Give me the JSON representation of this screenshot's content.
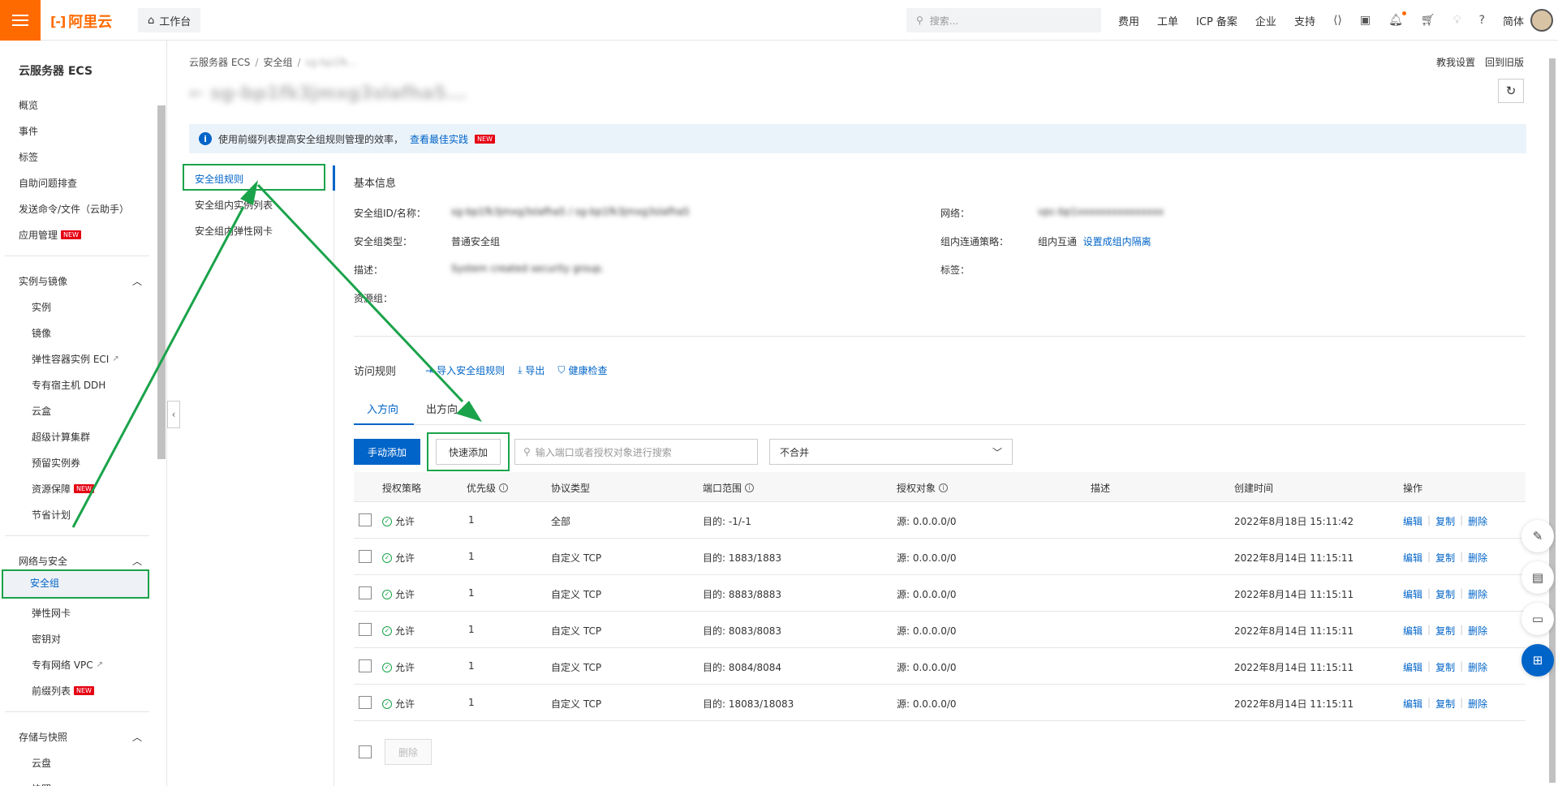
{
  "topbar": {
    "logo_text": "阿里云",
    "logo_mark": "[-]",
    "workbench_label": "工作台",
    "search_placeholder": "搜索...",
    "links": [
      "费用",
      "工单",
      "ICP 备案",
      "企业",
      "支持"
    ],
    "language": "简体",
    "icons": [
      "code-icon",
      "terminal-icon",
      "bell-icon",
      "cart-icon",
      "help-icon"
    ]
  },
  "sidebar": {
    "title": "云服务器 ECS",
    "top_items": [
      {
        "label": "概览"
      },
      {
        "label": "事件"
      },
      {
        "label": "标签"
      },
      {
        "label": "自助问题排查"
      },
      {
        "label": "发送命令/文件（云助手）"
      },
      {
        "label": "应用管理",
        "badge": "NEW"
      }
    ],
    "groups": [
      {
        "title": "实例与镜像",
        "items": [
          {
            "label": "实例"
          },
          {
            "label": "镜像"
          },
          {
            "label": "弹性容器实例 ECI",
            "external": true
          },
          {
            "label": "专有宿主机 DDH"
          },
          {
            "label": "云盒"
          },
          {
            "label": "超级计算集群"
          },
          {
            "label": "预留实例券"
          },
          {
            "label": "资源保障",
            "badge": "NEW"
          },
          {
            "label": "节省计划"
          }
        ]
      },
      {
        "title": "网络与安全",
        "items": [
          {
            "label": "安全组",
            "active": true
          },
          {
            "label": "弹性网卡"
          },
          {
            "label": "密钥对"
          },
          {
            "label": "专有网络 VPC",
            "external": true
          },
          {
            "label": "前缀列表",
            "badge": "NEW"
          }
        ]
      },
      {
        "title": "存储与快照",
        "items": [
          {
            "label": "云盘"
          },
          {
            "label": "快照"
          }
        ]
      }
    ]
  },
  "breadcrumb": [
    "云服务器 ECS",
    "安全组",
    "sg-bp1fk..."
  ],
  "top_right_links": [
    "教我设置",
    "回到旧版"
  ],
  "page_title": "sg-bp1fk3jmxg3slafha5...",
  "info_bar": {
    "text": "使用前缀列表提高安全组规则管理的效率，",
    "link": "查看最佳实践",
    "badge": "NEW"
  },
  "inner_nav": [
    "安全组规则",
    "安全组内实例列表",
    "安全组内弹性网卡"
  ],
  "basic_info": {
    "title": "基本信息",
    "fields": {
      "id_name_label": "安全组ID/名称：",
      "id_name_value": "sg-bp1fk3jmxg3slafha5 / sg-bp1fk3jmxg3slafha5",
      "type_label": "安全组类型：",
      "type_value": "普通安全组",
      "desc_label": "描述：",
      "desc_value": "System created security group.",
      "rg_label": "资源组：",
      "network_label": "网络：",
      "network_value": "vpc-bp1xxxxxxxxxxxxxxx",
      "policy_label": "组内连通策略：",
      "policy_value": "组内互通",
      "policy_link": "设置成组内隔离",
      "tags_label": "标签："
    }
  },
  "rules": {
    "title": "访问规则",
    "actions": [
      "导入安全组规则",
      "导出",
      "健康检查"
    ],
    "tabs": [
      "入方向",
      "出方向"
    ],
    "add_button": "手动添加",
    "quick_add_button": "快速添加",
    "search_placeholder": "输入端口或者授权对象进行搜索",
    "merge_select": "不合并",
    "columns": [
      "授权策略",
      "优先级",
      "协议类型",
      "端口范围",
      "授权对象",
      "描述",
      "创建时间",
      "操作"
    ],
    "rows": [
      {
        "policy": "允许",
        "priority": "1",
        "protocol": "全部",
        "port": "目的: -1/-1",
        "source": "源: 0.0.0.0/0",
        "desc": "",
        "created": "2022年8月18日 15:11:42"
      },
      {
        "policy": "允许",
        "priority": "1",
        "protocol": "自定义 TCP",
        "port": "目的: 1883/1883",
        "source": "源: 0.0.0.0/0",
        "desc": "",
        "created": "2022年8月14日 11:15:11"
      },
      {
        "policy": "允许",
        "priority": "1",
        "protocol": "自定义 TCP",
        "port": "目的: 8883/8883",
        "source": "源: 0.0.0.0/0",
        "desc": "",
        "created": "2022年8月14日 11:15:11"
      },
      {
        "policy": "允许",
        "priority": "1",
        "protocol": "自定义 TCP",
        "port": "目的: 8083/8083",
        "source": "源: 0.0.0.0/0",
        "desc": "",
        "created": "2022年8月14日 11:15:11"
      },
      {
        "policy": "允许",
        "priority": "1",
        "protocol": "自定义 TCP",
        "port": "目的: 8084/8084",
        "source": "源: 0.0.0.0/0",
        "desc": "",
        "created": "2022年8月14日 11:15:11"
      },
      {
        "policy": "允许",
        "priority": "1",
        "protocol": "自定义 TCP",
        "port": "目的: 18083/18083",
        "source": "源: 0.0.0.0/0",
        "desc": "",
        "created": "2022年8月14日 11:15:11"
      }
    ],
    "row_ops": [
      "编辑",
      "复制",
      "删除"
    ],
    "delete_button": "删除"
  },
  "colors": {
    "brand_orange": "#ff6a00",
    "primary_blue": "#0064c8",
    "annotation_green": "#1aa34a"
  }
}
